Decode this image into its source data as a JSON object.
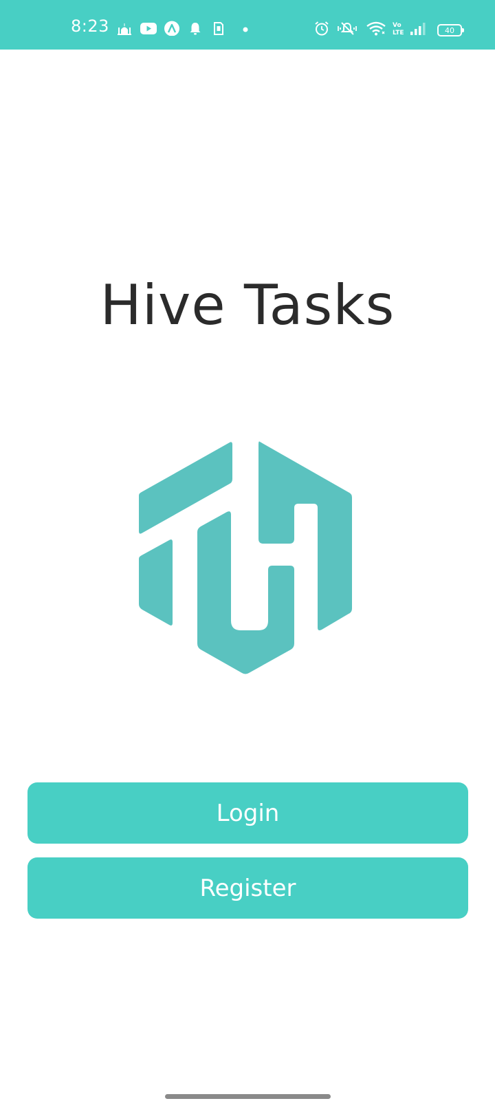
{
  "status_bar": {
    "time": "8:23",
    "battery_level": "40",
    "background_color": "#48cfc4",
    "icons": [
      "mosque-icon",
      "youtube-icon",
      "app-a-icon",
      "notification-bell-icon",
      "sim-card-icon",
      "dot-icon",
      "alarm-icon",
      "vibrate-off-icon",
      "wifi-icon",
      "volte-icon",
      "signal-icon",
      "battery-icon"
    ]
  },
  "app": {
    "title": "Hive Tasks",
    "logo": "hive-tasks-logo",
    "accent_color": "#48cfc4",
    "logo_color": "#5bc2bf"
  },
  "actions": {
    "login_label": "Login",
    "register_label": "Register"
  }
}
